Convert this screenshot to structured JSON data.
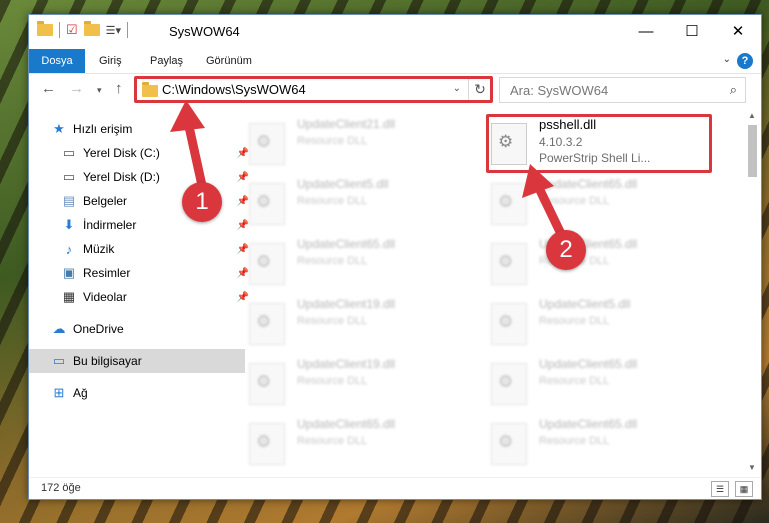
{
  "window": {
    "title": "SysWOW64"
  },
  "ribbon": {
    "tabs": [
      "Dosya",
      "Giriş",
      "Paylaş",
      "Görünüm"
    ]
  },
  "nav": {
    "address": "C:\\Windows\\SysWOW64",
    "search_placeholder": "Ara: SysWOW64"
  },
  "sidebar": {
    "items": [
      {
        "label": "Hızlı erişim",
        "icon": "star-icon"
      },
      {
        "label": "Yerel Disk (C:)",
        "icon": "drive-icon"
      },
      {
        "label": "Yerel Disk (D:)",
        "icon": "drive-icon"
      },
      {
        "label": "Belgeler",
        "icon": "documents-icon"
      },
      {
        "label": "İndirmeler",
        "icon": "download-icon"
      },
      {
        "label": "Müzik",
        "icon": "music-icon"
      },
      {
        "label": "Resimler",
        "icon": "pictures-icon"
      },
      {
        "label": "Videolar",
        "icon": "video-icon"
      },
      {
        "label": "OneDrive",
        "icon": "cloud-icon"
      },
      {
        "label": "Bu bilgisayar",
        "icon": "computer-icon"
      },
      {
        "label": "Ağ",
        "icon": "network-icon"
      }
    ]
  },
  "files": [
    {
      "name": "UpdateClient21.dll",
      "desc": "Resource DLL"
    },
    {
      "name": "psshell.dll",
      "version": "4.10.3.2",
      "desc": "PowerStrip Shell Li..."
    },
    {
      "name": "UpdateClient5.dll",
      "desc": "Resource DLL"
    },
    {
      "name": "UpdateClient65.dll",
      "desc": "Resource DLL"
    },
    {
      "name": "UpdateClient65.dll",
      "desc": "Resource DLL"
    },
    {
      "name": "UpdateClient65.dll",
      "desc": "Resource DLL"
    },
    {
      "name": "UpdateClient19.dll",
      "desc": "Resource DLL"
    },
    {
      "name": "UpdateClient5.dll",
      "desc": "Resource DLL"
    },
    {
      "name": "UpdateClient19.dll",
      "desc": "Resource DLL"
    },
    {
      "name": "UpdateClient65.dll",
      "desc": "Resource DLL"
    },
    {
      "name": "UpdateClient65.dll",
      "desc": "Resource DLL"
    },
    {
      "name": "UpdateClient65.dll",
      "desc": "Resource DLL"
    }
  ],
  "status": {
    "item_count": "172 öğe"
  },
  "callouts": [
    "1",
    "2"
  ],
  "colors": {
    "accent": "#1979ca",
    "highlight": "#d9363e"
  }
}
